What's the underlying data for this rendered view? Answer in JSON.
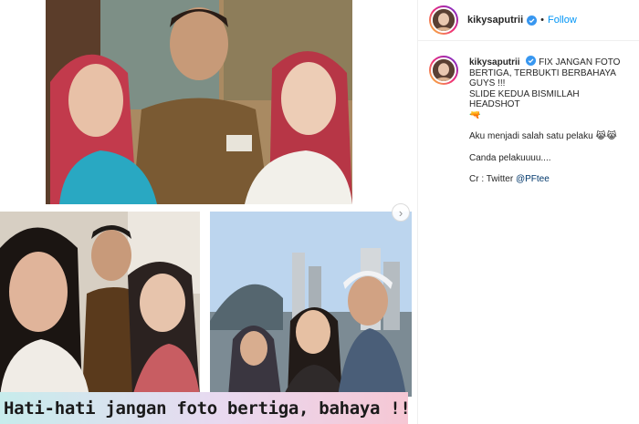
{
  "post": {
    "image_caption": "Hati-hati jangan foto bertiga, bahaya !!"
  },
  "header": {
    "username": "kikysaputrii",
    "separator": "•",
    "follow_label": "Follow"
  },
  "comment": {
    "username": "kikysaputrii",
    "line1_rest": "FIX JANGAN FOTO BERTIGA, TERBUKTI BERBAHAYA GUYS !!!",
    "line2": "SLIDE KEDUA BISMILLAH HEADSHOT",
    "line2_emoji": "🔫",
    "line3": "Aku menjadi salah satu pelaku",
    "line3_emoji": "😹😹",
    "line4": "Canda pelakuuuu....",
    "line5_prefix": "Cr : Twitter",
    "line5_mention": "@PFtee"
  },
  "icons": {
    "next": "chevron-right-icon",
    "verified": "verified-badge-icon"
  },
  "colors": {
    "accent": "#0095f6",
    "mention": "#00376b",
    "verified": "#3897f0"
  }
}
